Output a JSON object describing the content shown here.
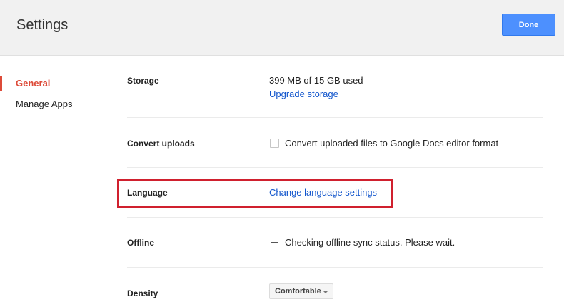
{
  "header": {
    "title": "Settings",
    "done_label": "Done"
  },
  "sidebar": {
    "items": [
      {
        "label": "General"
      },
      {
        "label": "Manage Apps"
      }
    ]
  },
  "settings": {
    "storage": {
      "label": "Storage",
      "usage": "399 MB of 15 GB used",
      "upgrade_link": "Upgrade storage"
    },
    "convert": {
      "label": "Convert uploads",
      "checkbox_text": "Convert uploaded files to Google Docs editor format",
      "checked": false
    },
    "language": {
      "label": "Language",
      "link": "Change language settings"
    },
    "offline": {
      "label": "Offline",
      "status": "Checking offline sync status. Please wait."
    },
    "density": {
      "label": "Density",
      "selected": "Comfortable"
    }
  },
  "colors": {
    "accent": "#dd4b39",
    "primary_button": "#4d90fe",
    "link": "#1155cc",
    "highlight": "#d0202e"
  }
}
